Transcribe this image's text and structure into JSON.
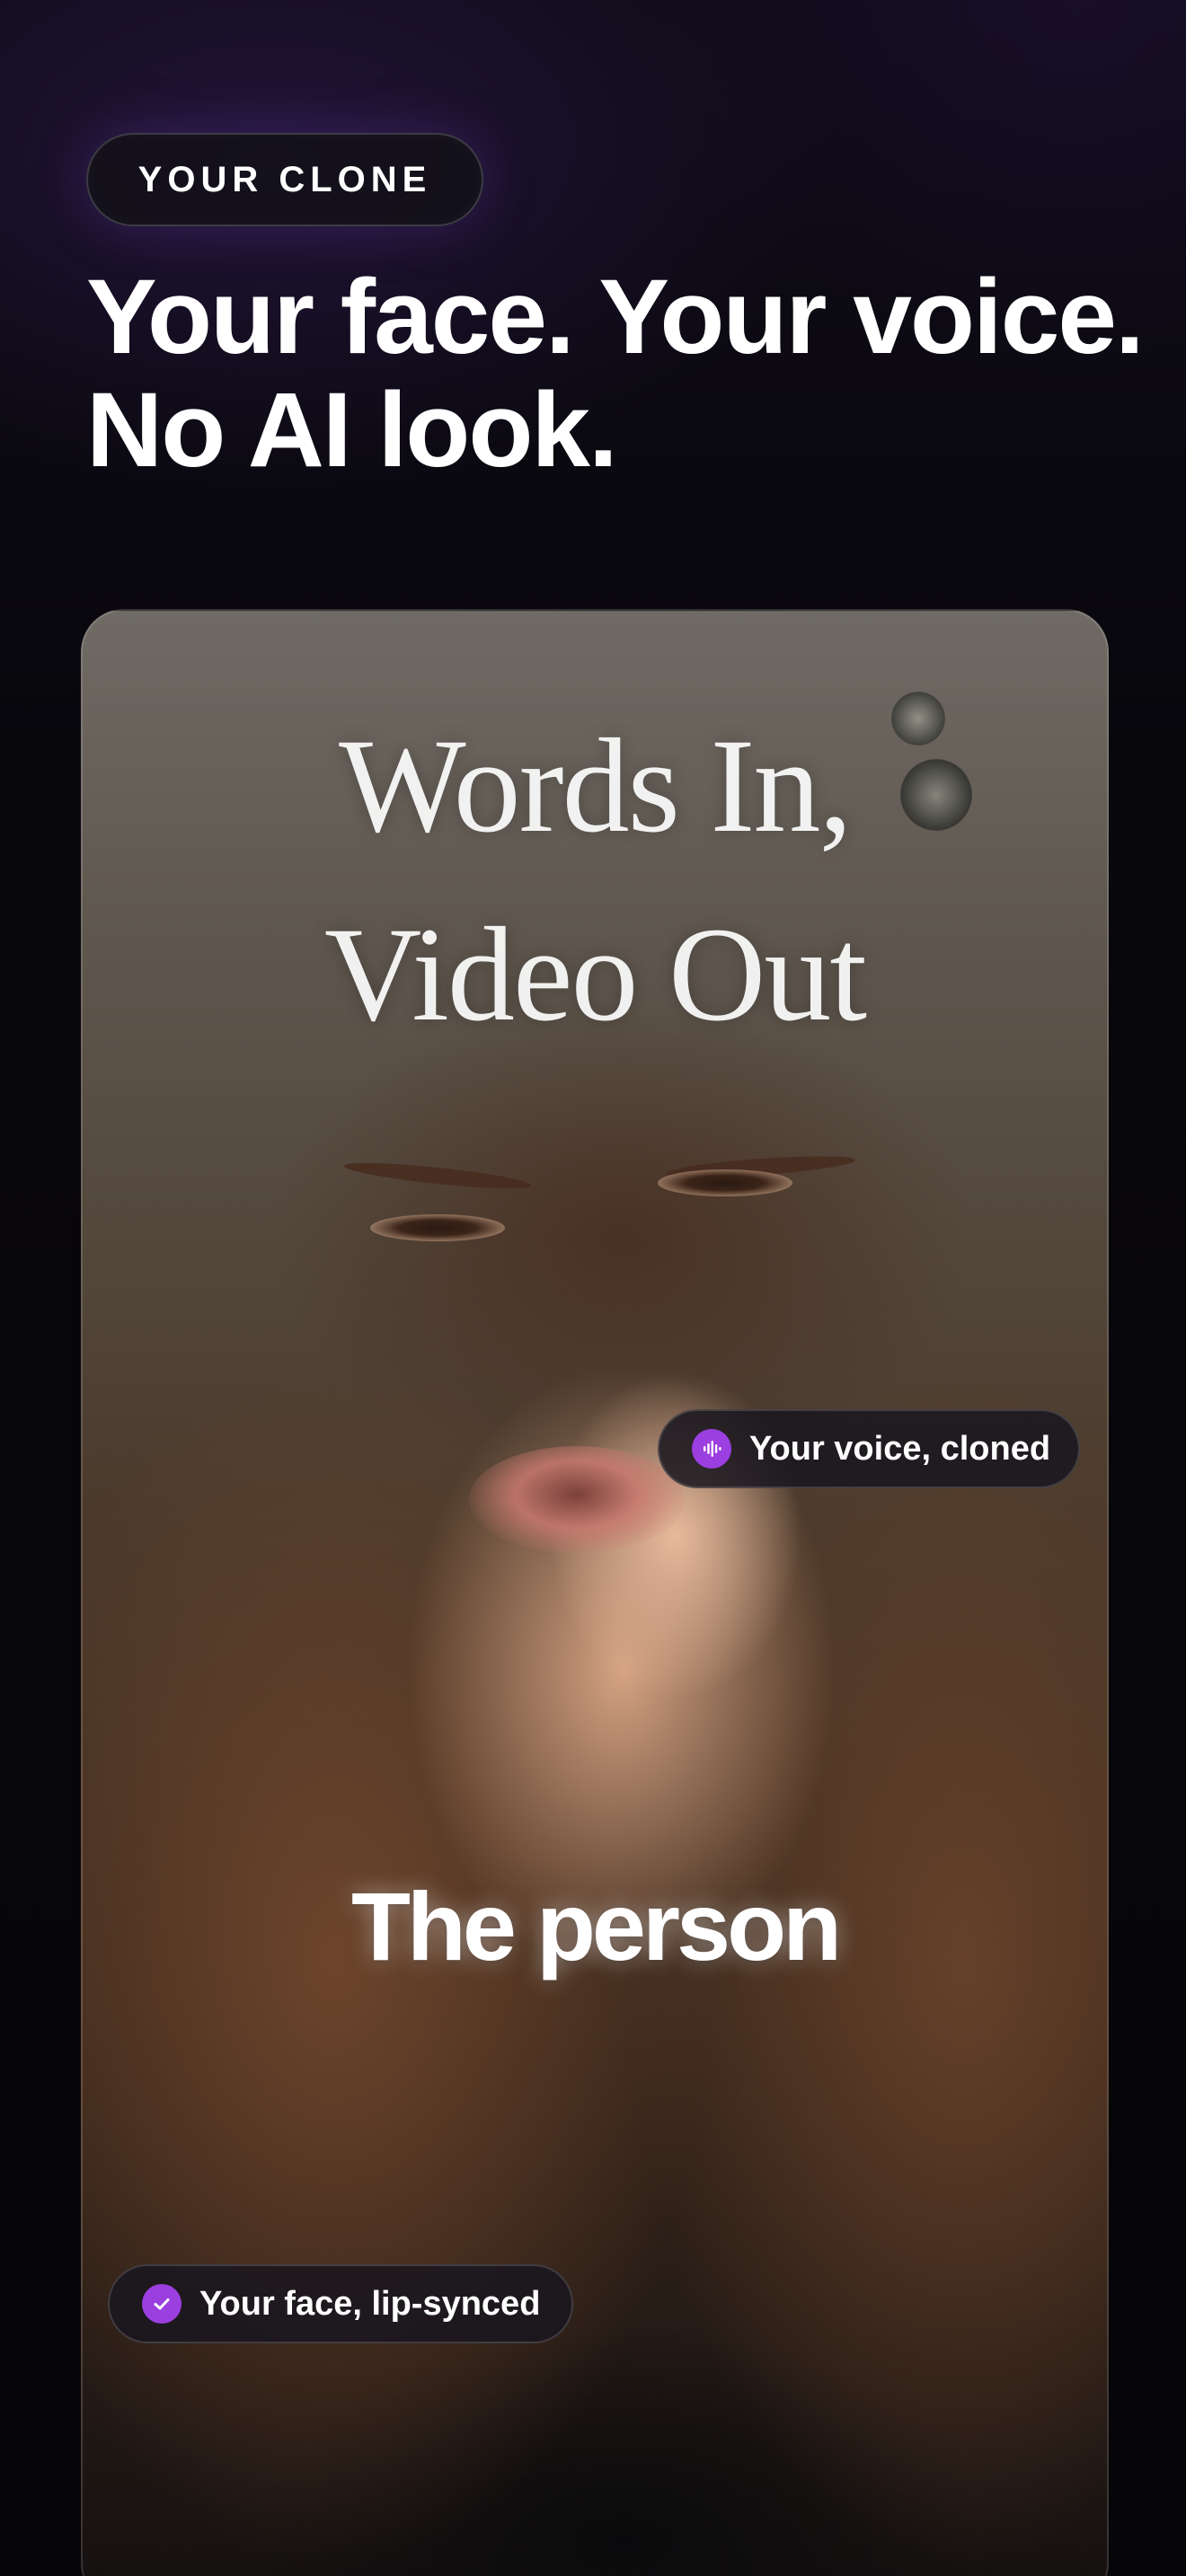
{
  "tag": {
    "label": "YOUR CLONE"
  },
  "headline": {
    "line1": "Your face. Your voice.",
    "line2": "No AI look."
  },
  "video": {
    "title_line1": "Words In,",
    "title_line2": "Video Out",
    "caption": "The person",
    "voice_chip": {
      "label": "Your voice, cloned",
      "icon": "waveform-icon"
    },
    "face_chip": {
      "label": "Your face, lip-synced",
      "icon": "check-icon"
    }
  },
  "colors": {
    "background": "#07060b",
    "accent": "#9b3fe0",
    "text": "#ffffff"
  }
}
